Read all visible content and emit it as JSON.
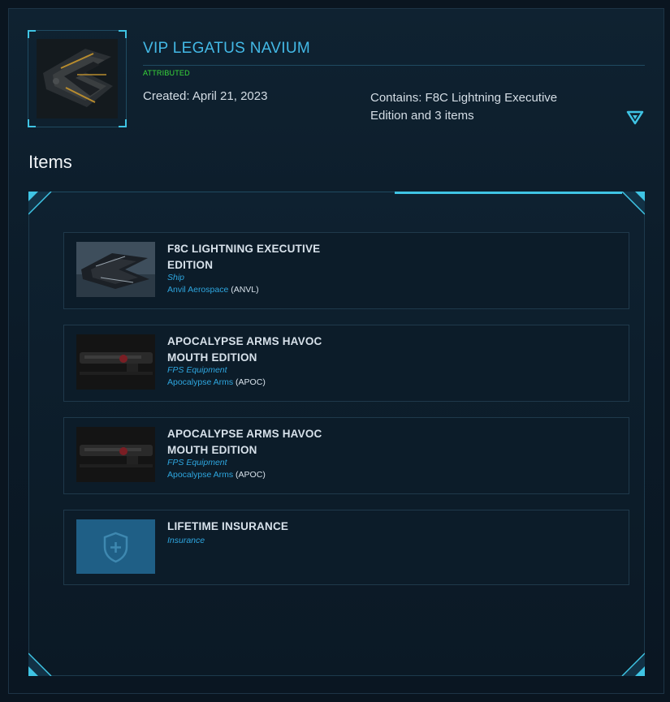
{
  "package": {
    "title": "VIP LEGATUS NAVIUM",
    "status": "ATTRIBUTED",
    "created": "Created: April 21, 2023",
    "contains": "Contains: F8C Lightning Executive Edition and 3 items",
    "expand_icon": "triangle-down-icon"
  },
  "section": {
    "title": "Items"
  },
  "items": [
    {
      "name": "F8C LIGHTNING EXECUTIVE EDITION",
      "type": "Ship",
      "manufacturer": "Anvil Aerospace",
      "code_open": " (",
      "code": "ANVL",
      "code_close": ")"
    },
    {
      "name": "APOCALYPSE ARMS HAVOC MOUTH EDITION",
      "type": "FPS Equipment",
      "manufacturer": "Apocalypse Arms",
      "code_open": " (",
      "code": "APOC",
      "code_close": ")"
    },
    {
      "name": "APOCALYPSE ARMS HAVOC MOUTH EDITION",
      "type": "FPS Equipment",
      "manufacturer": "Apocalypse Arms",
      "code_open": " (",
      "code": "APOC",
      "code_close": ")"
    },
    {
      "name": "LIFETIME INSURANCE",
      "type": "Insurance",
      "icon": "shield-plus-icon"
    }
  ],
  "colors": {
    "accent": "#3fc4e4",
    "title": "#43b9e6",
    "status": "#39d939",
    "link": "#2ea6df"
  }
}
